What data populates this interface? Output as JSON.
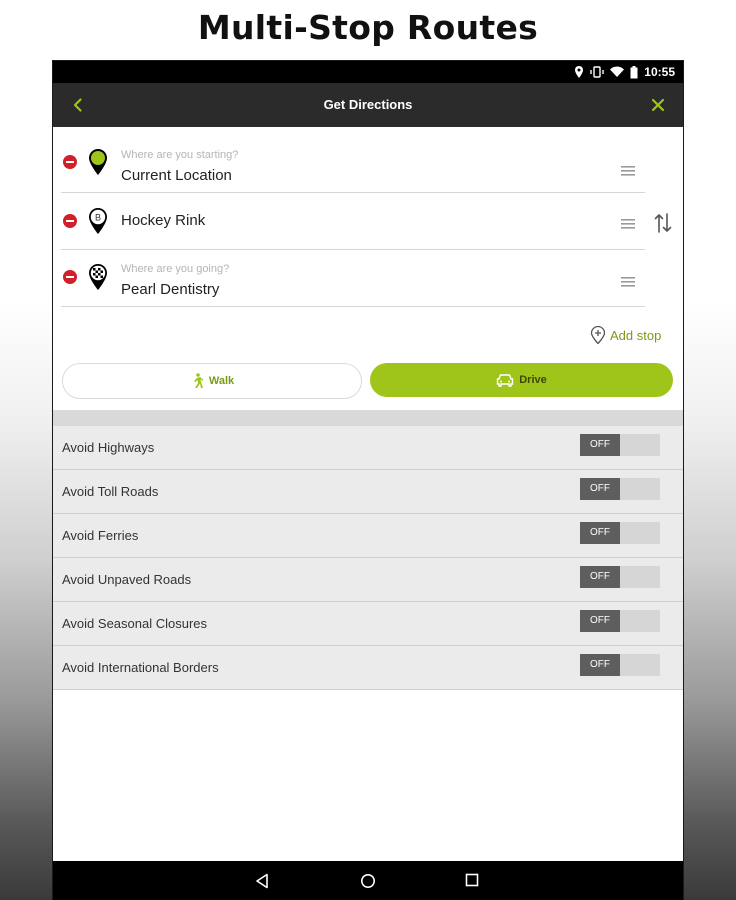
{
  "promo": {
    "title": "Multi-Stop Routes"
  },
  "status_bar": {
    "time": "10:55"
  },
  "app_bar": {
    "title": "Get Directions",
    "back_icon": "back-chevron-icon",
    "close_icon": "close-icon"
  },
  "stops": [
    {
      "hint": "Where are you starting?",
      "value": "Current Location",
      "marker": "start"
    },
    {
      "hint": "",
      "value": "Hockey Rink",
      "marker": "B"
    },
    {
      "hint": "Where are you going?",
      "value": "Pearl Dentistry",
      "marker": "finish"
    }
  ],
  "add_stop": {
    "label": "Add stop"
  },
  "modes": {
    "walk_label": "Walk",
    "drive_label": "Drive",
    "selected": "drive"
  },
  "settings": [
    {
      "label": "Avoid Highways",
      "state": "OFF"
    },
    {
      "label": "Avoid Toll Roads",
      "state": "OFF"
    },
    {
      "label": "Avoid Ferries",
      "state": "OFF"
    },
    {
      "label": "Avoid Unpaved Roads",
      "state": "OFF"
    },
    {
      "label": "Avoid Seasonal Closures",
      "state": "OFF"
    },
    {
      "label": "Avoid International Borders",
      "state": "OFF"
    }
  ],
  "colors": {
    "accent": "#9fc51a",
    "app_bar": "#2b2b2b",
    "remove": "#d0202a"
  }
}
